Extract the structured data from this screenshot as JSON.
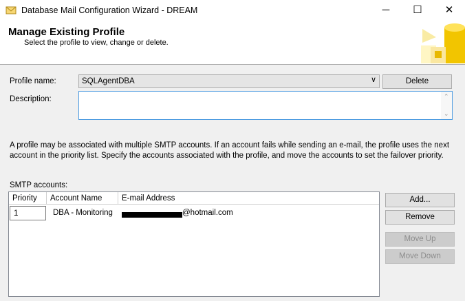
{
  "window": {
    "title": "Database Mail Configuration Wizard - DREAM",
    "minimize_glyph": "─",
    "maximize_glyph": "☐",
    "close_glyph": "✕"
  },
  "header": {
    "title": "Manage Existing Profile",
    "subtitle": "Select the profile to view, change or delete.",
    "logo_icon": "database-mail-icon"
  },
  "profile": {
    "name_label": "Profile name:",
    "selected": "SQLAgentDBA",
    "dropdown_glyph": "∨",
    "delete_label": "Delete",
    "description_label": "Description:",
    "description_value": ""
  },
  "info_text": "A profile may be associated with multiple SMTP accounts. If an account fails while sending an e-mail, the profile uses the next account in the priority list. Specify the accounts associated with the profile, and move the accounts to set the failover priority.",
  "smtp": {
    "label": "SMTP accounts:",
    "columns": [
      "Priority",
      "Account Name",
      "E-mail Address"
    ],
    "rows": [
      {
        "priority": "1",
        "account_name": "DBA - Monitoring",
        "email_visible": "@hotmail.com"
      }
    ],
    "buttons": {
      "add": "Add...",
      "remove": "Remove",
      "move_up": "Move Up",
      "move_down": "Move Down"
    }
  },
  "colors": {
    "accent_border": "#4f9ce1",
    "dialog_bg": "#f0f0f0",
    "logo_yellow": "#f2c500"
  }
}
